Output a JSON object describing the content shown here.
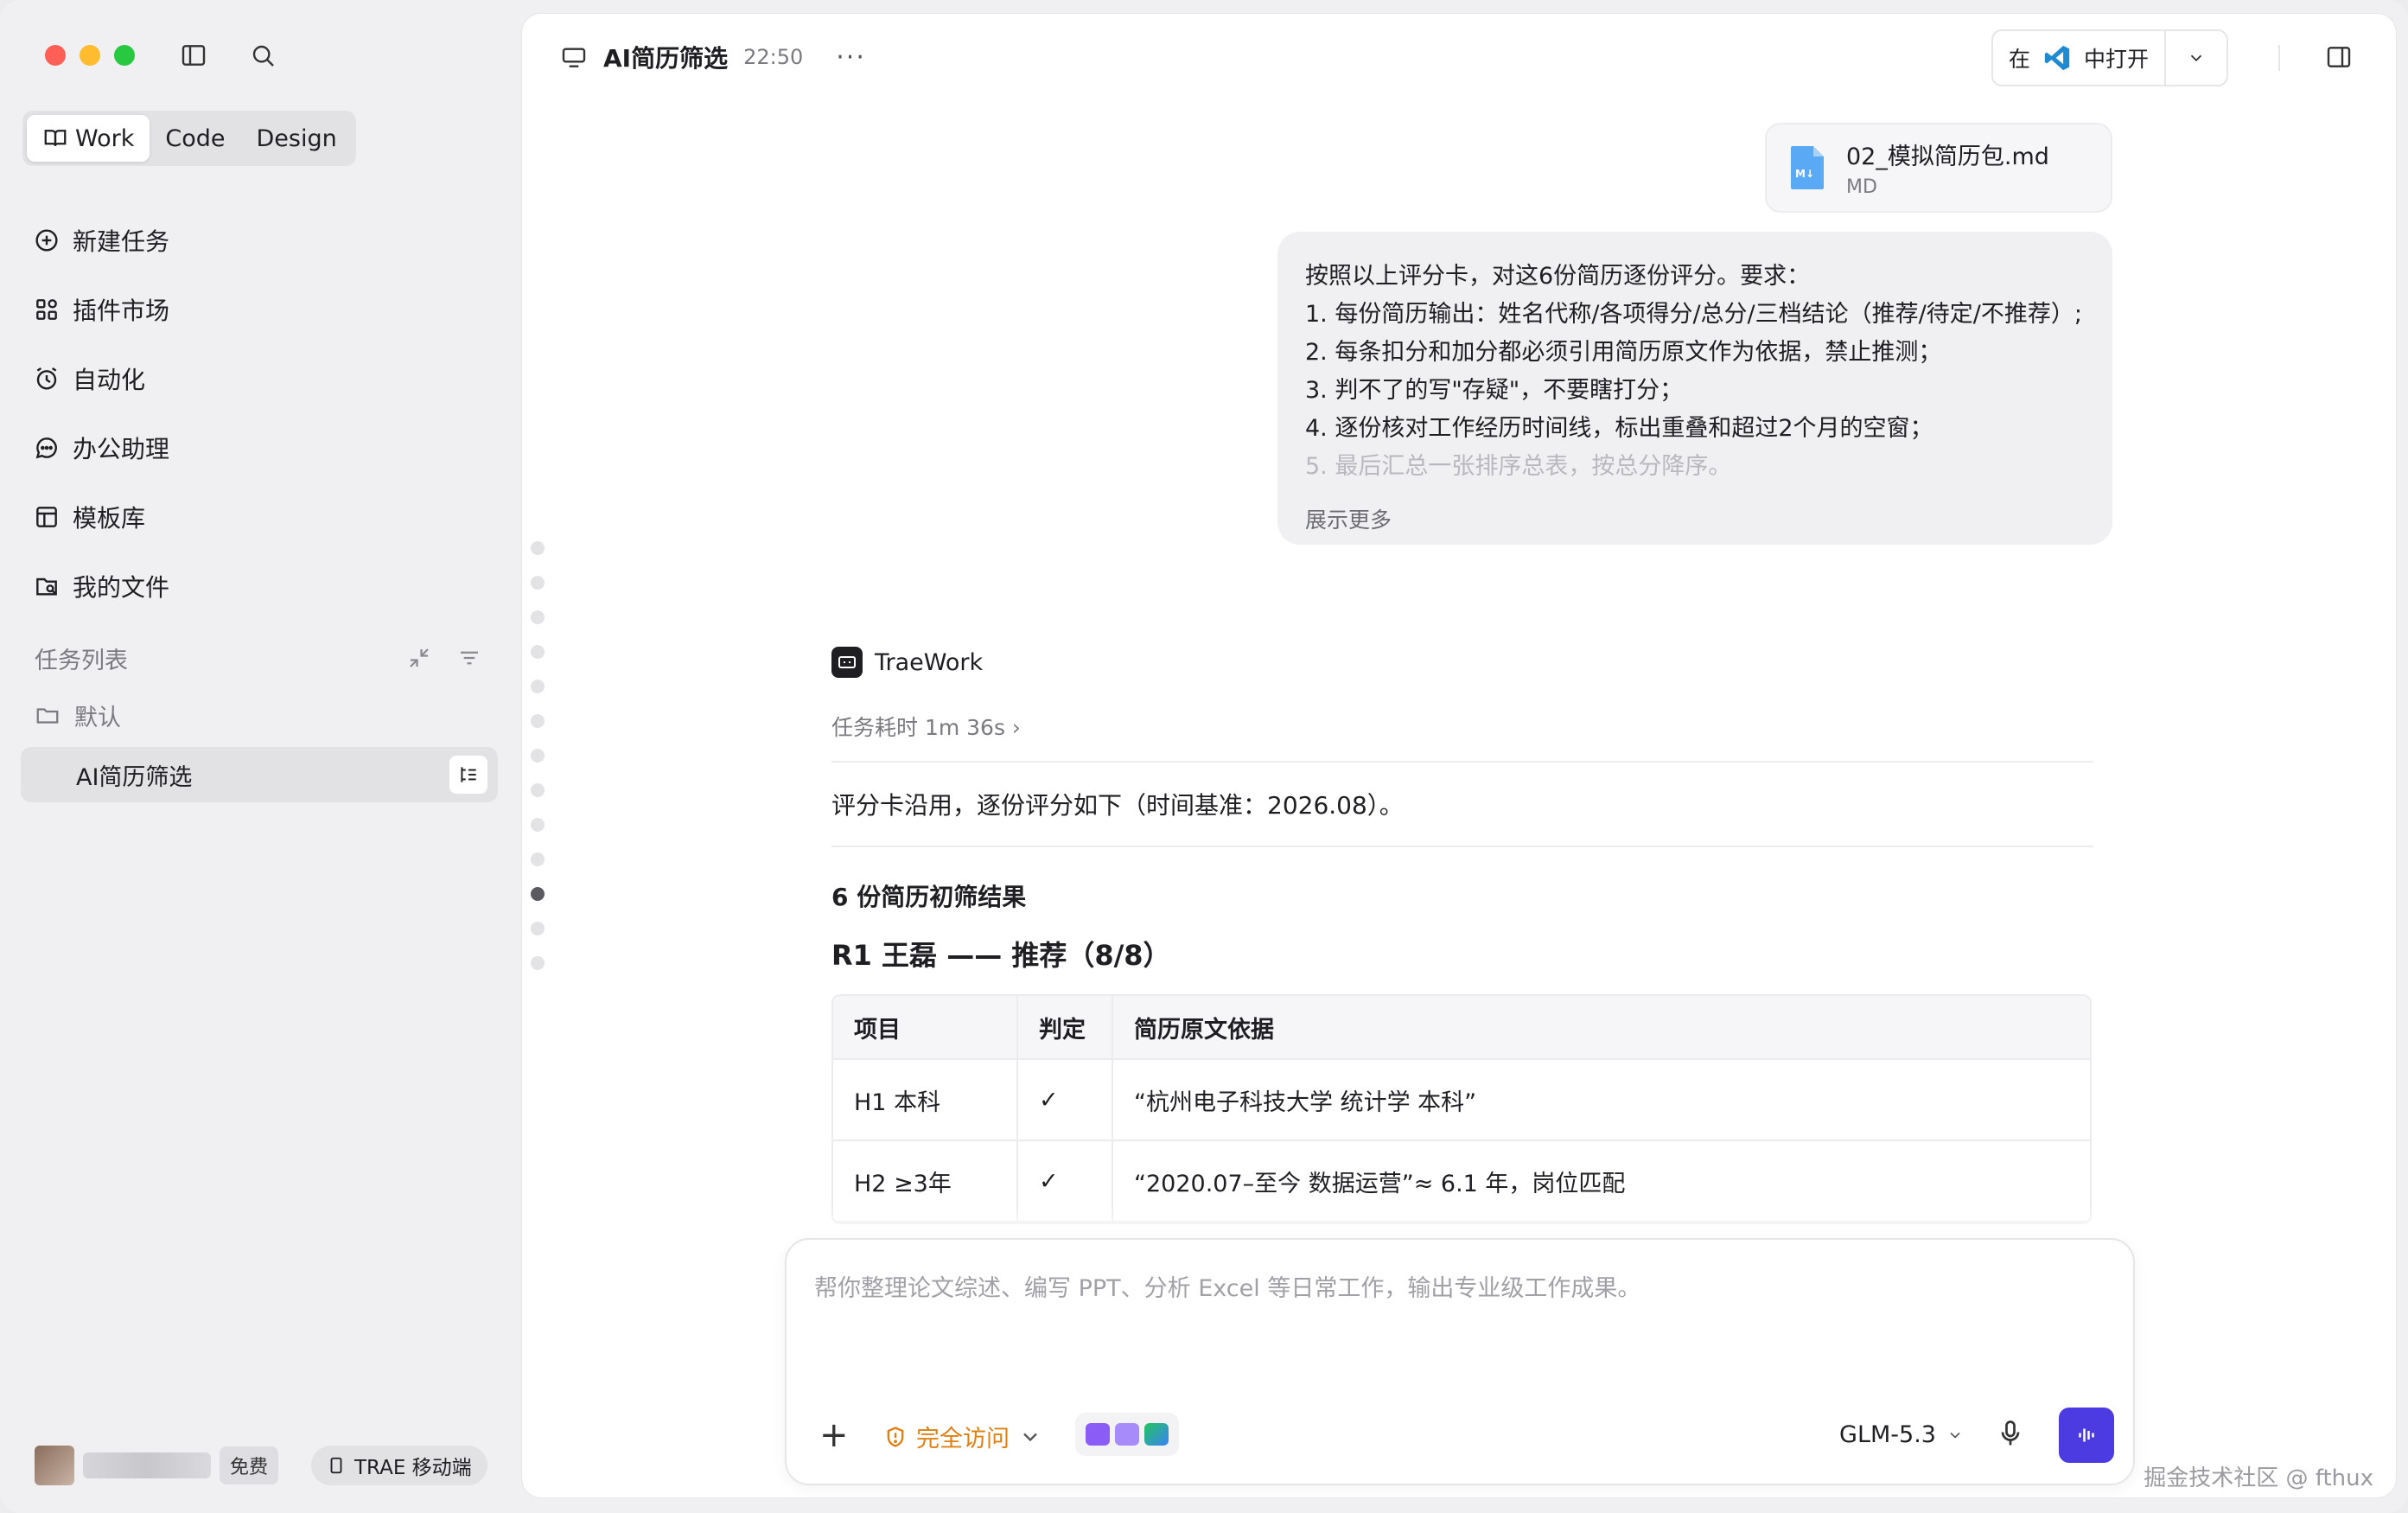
{
  "sidebar": {
    "modes": [
      {
        "label": "Work",
        "active": true
      },
      {
        "label": "Code",
        "active": false
      },
      {
        "label": "Design",
        "active": false
      }
    ],
    "nav": [
      {
        "label": "新建任务",
        "icon": "plus-circle-icon"
      },
      {
        "label": "插件市场",
        "icon": "plugin-grid-icon"
      },
      {
        "label": "自动化",
        "icon": "alarm-clock-icon"
      },
      {
        "label": "办公助理",
        "icon": "chat-bubble-icon"
      },
      {
        "label": "模板库",
        "icon": "template-icon"
      },
      {
        "label": "我的文件",
        "icon": "file-folder-icon"
      }
    ],
    "task_section_title": "任务列表",
    "folder_label": "默认",
    "active_task": "AI简历筛选",
    "user_badge": "免费",
    "mobile_label": "TRAE 移动端"
  },
  "topbar": {
    "title": "AI简历筛选",
    "time": "22:50",
    "more": "···",
    "open_in_prefix": "在",
    "open_in_suffix": "中打开"
  },
  "chat": {
    "file_card": {
      "name": "02_模拟简历包.md",
      "type": "MD"
    },
    "user_message": [
      "按照以上评分卡，对这6份简历逐份评分。要求：",
      "1. 每份简历输出：姓名代称/各项得分/总分/三档结论（推荐/待定/不推荐）;",
      "2. 每条扣分和加分都必须引用简历原文作为依据，禁止推测；",
      "3. 判不了的写\"存疑\"，不要瞎打分；",
      "4. 逐份核对工作经历时间线，标出重叠和超过2个月的空窗；",
      "5. 最后汇总一张排序总表，按总分降序。"
    ],
    "expand_label": "展示更多",
    "assistant_name": "TraeWork",
    "duration": "任务耗时 1m 36s ›",
    "intro": "评分卡沿用，逐份评分如下（时间基准：2026.08）。",
    "section_title": "6 份简历初筛结果",
    "candidate_title": "R1 王磊 —— 推荐（8/8）",
    "table": {
      "headers": [
        "项目",
        "判定",
        "简历原文依据"
      ],
      "rows": [
        [
          "H1 本科",
          "✓",
          "“杭州电子科技大学 统计学 本科”"
        ],
        [
          "H2 ≥3年",
          "✓",
          "“2020.07–至今 数据运营”≈ 6.1 年，岗位匹配"
        ]
      ]
    }
  },
  "composer": {
    "placeholder": "帮你整理论文综述、编写 PPT、分析 Excel 等日常工作，输出专业级工作成果。",
    "access_label": "完全访问",
    "model": "GLM-5.3"
  },
  "watermark": "掘金技术社区 @ fthux",
  "colors": {
    "accent": "#4b3be0",
    "warning": "#e07f12"
  }
}
